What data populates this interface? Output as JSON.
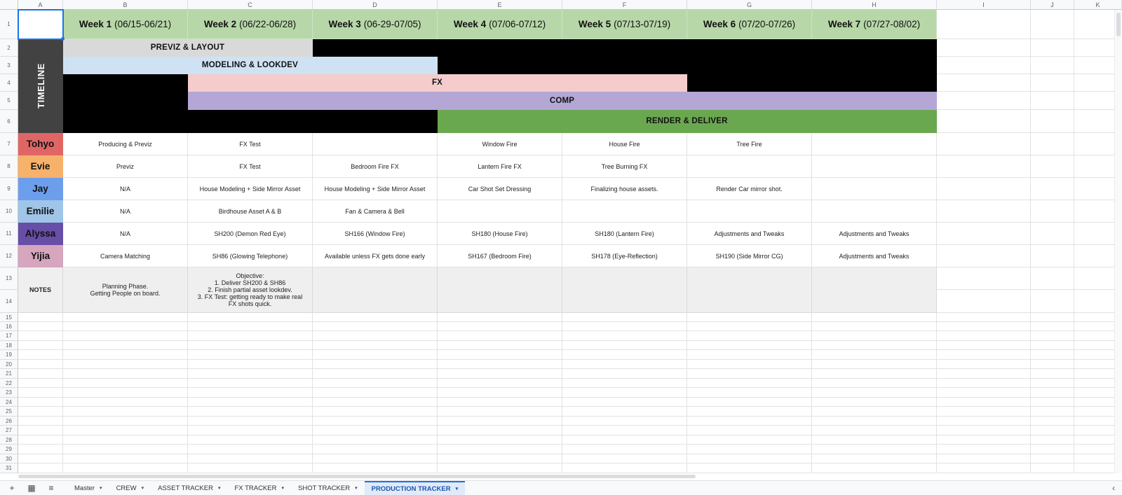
{
  "columns": [
    "A",
    "B",
    "C",
    "D",
    "E",
    "F",
    "G",
    "H",
    "I",
    "J",
    "K"
  ],
  "rows": [
    "1",
    "2",
    "3",
    "4",
    "5",
    "6",
    "7",
    "8",
    "9",
    "10",
    "11",
    "12",
    "13",
    "14",
    "15",
    "16",
    "17",
    "18",
    "19",
    "20",
    "21",
    "22",
    "23",
    "24",
    "25",
    "26",
    "27",
    "28",
    "29",
    "30",
    "31"
  ],
  "weeks": [
    {
      "label": "Week 1",
      "range": "(06/15-06/21)"
    },
    {
      "label": "Week 2",
      "range": "(06/22-06/28)"
    },
    {
      "label": "Week 3",
      "range": "(06-29-07/05)"
    },
    {
      "label": "Week 4",
      "range": "(07/06-07/12)"
    },
    {
      "label": "Week 5",
      "range": "(07/13-07/19)"
    },
    {
      "label": "Week 6",
      "range": "(07/20-07/26)"
    },
    {
      "label": "Week 7",
      "range": "(07/27-08/02)"
    }
  ],
  "timeline": {
    "label": "TIMELINE",
    "bars": [
      {
        "label": "PREVIZ  & LAYOUT",
        "color": "#d9d9d9"
      },
      {
        "label": "MODELING & LOOKDEV",
        "color": "#cfe2f3"
      },
      {
        "label": "FX",
        "color": "#f4cccc"
      },
      {
        "label": "COMP",
        "color": "#b4a7d6"
      },
      {
        "label": "RENDER & DELIVER",
        "color": "#6aa84f"
      }
    ]
  },
  "crew": [
    {
      "name": "Tohyo",
      "color": "#e06666",
      "tasks": [
        "Producing & Previz",
        "FX Test",
        "",
        "Window Fire",
        "House Fire",
        "Tree Fire",
        ""
      ]
    },
    {
      "name": "Evie",
      "color": "#f6b26b",
      "tasks": [
        "Previz",
        "FX Test",
        "Bedroom Fire FX",
        "Lantern Fire FX",
        "Tree Burning FX",
        "",
        ""
      ]
    },
    {
      "name": "Jay",
      "color": "#6d9eeb",
      "tasks": [
        "N/A",
        "House Modeling + Side Mirror Asset",
        "House Modeling + Side Mirror Asset",
        "Car Shot Set Dressing",
        "Finalizing house assets.",
        "Render Car mirror shot.",
        ""
      ]
    },
    {
      "name": "Emilie",
      "color": "#9fc5e8",
      "tasks": [
        "N/A",
        "Birdhouse Asset A & B",
        "Fan & Camera & Bell",
        "",
        "",
        "",
        ""
      ]
    },
    {
      "name": "Alyssa",
      "color": "#674ea7",
      "tasks": [
        "N/A",
        "SH200 (Demon Red Eye)",
        "SH166 (Window Fire)",
        "SH180 (House Fire)",
        "SH180 (Lantern Fire)",
        "Adjustments and Tweaks",
        "Adjustments and Tweaks"
      ]
    },
    {
      "name": "Yijia",
      "color": "#d5a6bd",
      "tasks": [
        "Camera Matching",
        "SH86 (Glowing Telephone)",
        "Available unless FX gets done early",
        "SH167 (Bedroom Fire)",
        "SH178 (Eye-Reflection)",
        "SH190 (Side Mirror CG)",
        "Adjustments and Tweaks"
      ]
    }
  ],
  "notes": {
    "label": "NOTES",
    "cells": [
      [
        "Planning Phase.",
        "Getting People on board."
      ],
      [
        "Objective:",
        "1. Deliver SH200 & SH86",
        "2. Finish partial asset lookdev.",
        "3. FX Test: getting ready to make real FX shots quick."
      ],
      [],
      [],
      [],
      [],
      []
    ]
  },
  "sheet_tabs": [
    {
      "label": "Master",
      "active": false
    },
    {
      "label": "CREW",
      "active": false
    },
    {
      "label": "ASSET TRACKER",
      "active": false
    },
    {
      "label": "FX TRACKER",
      "active": false
    },
    {
      "label": "SHOT TRACKER",
      "active": false
    },
    {
      "label": "PRODUCTION TRACKER",
      "active": true
    }
  ],
  "icons": {
    "add_sheet": "plus-icon",
    "all_sheets": "sheets-list-icon",
    "menu": "hamburger-icon",
    "tab_caret": "caret-down-icon",
    "collapse": "chevron-left-icon"
  },
  "colors": {
    "week_header": "#b7d7a8",
    "timeline_bg": "#424242",
    "selection": "#1a73e8",
    "active_tab": "#1a56b0"
  }
}
